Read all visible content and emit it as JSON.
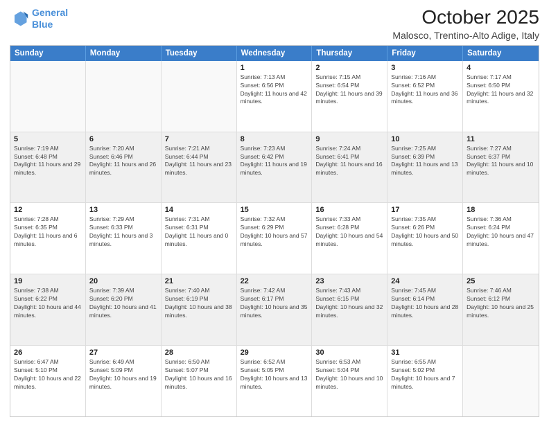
{
  "header": {
    "logo_line1": "General",
    "logo_line2": "Blue",
    "title": "October 2025",
    "subtitle": "Malosco, Trentino-Alto Adige, Italy"
  },
  "weekdays": [
    "Sunday",
    "Monday",
    "Tuesday",
    "Wednesday",
    "Thursday",
    "Friday",
    "Saturday"
  ],
  "rows": [
    [
      {
        "day": "",
        "info": ""
      },
      {
        "day": "",
        "info": ""
      },
      {
        "day": "",
        "info": ""
      },
      {
        "day": "1",
        "info": "Sunrise: 7:13 AM\nSunset: 6:56 PM\nDaylight: 11 hours and 42 minutes."
      },
      {
        "day": "2",
        "info": "Sunrise: 7:15 AM\nSunset: 6:54 PM\nDaylight: 11 hours and 39 minutes."
      },
      {
        "day": "3",
        "info": "Sunrise: 7:16 AM\nSunset: 6:52 PM\nDaylight: 11 hours and 36 minutes."
      },
      {
        "day": "4",
        "info": "Sunrise: 7:17 AM\nSunset: 6:50 PM\nDaylight: 11 hours and 32 minutes."
      }
    ],
    [
      {
        "day": "5",
        "info": "Sunrise: 7:19 AM\nSunset: 6:48 PM\nDaylight: 11 hours and 29 minutes."
      },
      {
        "day": "6",
        "info": "Sunrise: 7:20 AM\nSunset: 6:46 PM\nDaylight: 11 hours and 26 minutes."
      },
      {
        "day": "7",
        "info": "Sunrise: 7:21 AM\nSunset: 6:44 PM\nDaylight: 11 hours and 23 minutes."
      },
      {
        "day": "8",
        "info": "Sunrise: 7:23 AM\nSunset: 6:42 PM\nDaylight: 11 hours and 19 minutes."
      },
      {
        "day": "9",
        "info": "Sunrise: 7:24 AM\nSunset: 6:41 PM\nDaylight: 11 hours and 16 minutes."
      },
      {
        "day": "10",
        "info": "Sunrise: 7:25 AM\nSunset: 6:39 PM\nDaylight: 11 hours and 13 minutes."
      },
      {
        "day": "11",
        "info": "Sunrise: 7:27 AM\nSunset: 6:37 PM\nDaylight: 11 hours and 10 minutes."
      }
    ],
    [
      {
        "day": "12",
        "info": "Sunrise: 7:28 AM\nSunset: 6:35 PM\nDaylight: 11 hours and 6 minutes."
      },
      {
        "day": "13",
        "info": "Sunrise: 7:29 AM\nSunset: 6:33 PM\nDaylight: 11 hours and 3 minutes."
      },
      {
        "day": "14",
        "info": "Sunrise: 7:31 AM\nSunset: 6:31 PM\nDaylight: 11 hours and 0 minutes."
      },
      {
        "day": "15",
        "info": "Sunrise: 7:32 AM\nSunset: 6:29 PM\nDaylight: 10 hours and 57 minutes."
      },
      {
        "day": "16",
        "info": "Sunrise: 7:33 AM\nSunset: 6:28 PM\nDaylight: 10 hours and 54 minutes."
      },
      {
        "day": "17",
        "info": "Sunrise: 7:35 AM\nSunset: 6:26 PM\nDaylight: 10 hours and 50 minutes."
      },
      {
        "day": "18",
        "info": "Sunrise: 7:36 AM\nSunset: 6:24 PM\nDaylight: 10 hours and 47 minutes."
      }
    ],
    [
      {
        "day": "19",
        "info": "Sunrise: 7:38 AM\nSunset: 6:22 PM\nDaylight: 10 hours and 44 minutes."
      },
      {
        "day": "20",
        "info": "Sunrise: 7:39 AM\nSunset: 6:20 PM\nDaylight: 10 hours and 41 minutes."
      },
      {
        "day": "21",
        "info": "Sunrise: 7:40 AM\nSunset: 6:19 PM\nDaylight: 10 hours and 38 minutes."
      },
      {
        "day": "22",
        "info": "Sunrise: 7:42 AM\nSunset: 6:17 PM\nDaylight: 10 hours and 35 minutes."
      },
      {
        "day": "23",
        "info": "Sunrise: 7:43 AM\nSunset: 6:15 PM\nDaylight: 10 hours and 32 minutes."
      },
      {
        "day": "24",
        "info": "Sunrise: 7:45 AM\nSunset: 6:14 PM\nDaylight: 10 hours and 28 minutes."
      },
      {
        "day": "25",
        "info": "Sunrise: 7:46 AM\nSunset: 6:12 PM\nDaylight: 10 hours and 25 minutes."
      }
    ],
    [
      {
        "day": "26",
        "info": "Sunrise: 6:47 AM\nSunset: 5:10 PM\nDaylight: 10 hours and 22 minutes."
      },
      {
        "day": "27",
        "info": "Sunrise: 6:49 AM\nSunset: 5:09 PM\nDaylight: 10 hours and 19 minutes."
      },
      {
        "day": "28",
        "info": "Sunrise: 6:50 AM\nSunset: 5:07 PM\nDaylight: 10 hours and 16 minutes."
      },
      {
        "day": "29",
        "info": "Sunrise: 6:52 AM\nSunset: 5:05 PM\nDaylight: 10 hours and 13 minutes."
      },
      {
        "day": "30",
        "info": "Sunrise: 6:53 AM\nSunset: 5:04 PM\nDaylight: 10 hours and 10 minutes."
      },
      {
        "day": "31",
        "info": "Sunrise: 6:55 AM\nSunset: 5:02 PM\nDaylight: 10 hours and 7 minutes."
      },
      {
        "day": "",
        "info": ""
      }
    ]
  ]
}
